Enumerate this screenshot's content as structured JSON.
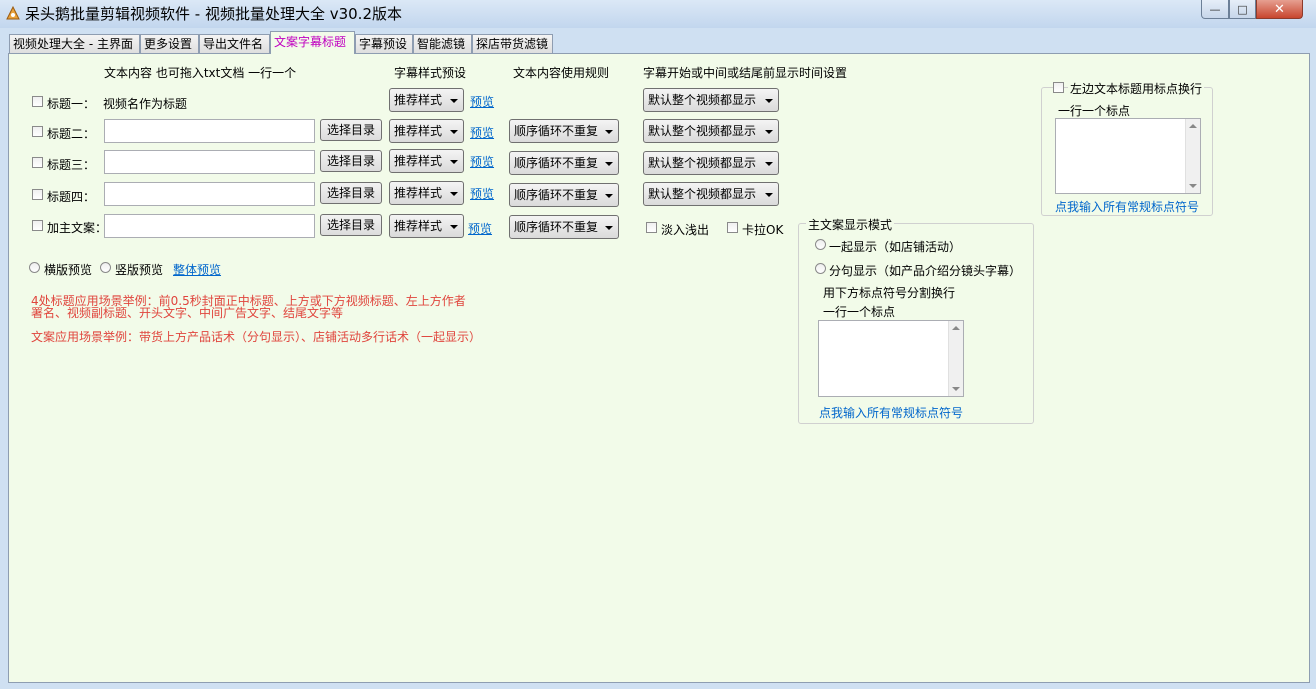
{
  "window": {
    "title": "呆头鹅批量剪辑视频软件 -  视频批量处理大全  v30.2版本",
    "min_glyph": "—",
    "max_glyph": "□",
    "close_glyph": "✕"
  },
  "tabs": [
    "视频处理大全 - 主界面",
    "更多设置",
    "导出文件名",
    "文案字幕标题",
    "字幕预设",
    "智能滤镜",
    "探店带货滤镜"
  ],
  "active_tab_index": 3,
  "headers": {
    "text_content": "文本内容 也可拖入txt文档 一行一个",
    "style_preset": "字幕样式预设",
    "usage_rule": "文本内容使用规则",
    "display_time": "字幕开始或中间或结尾前显示时间设置"
  },
  "rows": {
    "title1": {
      "label": "标题一：",
      "text": "视频名作为标题",
      "style": "推荐样式",
      "preview": "预览",
      "time": "默认整个视频都显示"
    },
    "title2": {
      "label": "标题二：",
      "value": "",
      "choose": "选择目录",
      "style": "推荐样式",
      "preview": "预览",
      "rule": "顺序循环不重复",
      "time": "默认整个视频都显示"
    },
    "title3": {
      "label": "标题三：",
      "value": "",
      "choose": "选择目录",
      "style": "推荐样式",
      "preview": "预览",
      "rule": "顺序循环不重复",
      "time": "默认整个视频都显示"
    },
    "title4": {
      "label": "标题四：",
      "value": "",
      "choose": "选择目录",
      "style": "推荐样式",
      "preview": "预览",
      "rule": "顺序循环不重复",
      "time": "默认整个视频都显示"
    },
    "main": {
      "label": "加主文案：",
      "value": "",
      "choose": "选择目录",
      "style": "推荐样式",
      "preview": "预览",
      "rule": "顺序循环不重复"
    }
  },
  "effects": {
    "fade": "淡入浅出",
    "karaoke": "卡拉OK"
  },
  "preview_options": {
    "landscape": "横版预览",
    "portrait": "竖版预览",
    "overall": "整体预览"
  },
  "notes": {
    "line1": "4处标题应用场景举例：前0.5秒封面正中标题、上方或下方视频标题、左上方作者",
    "line2": "署名、视频副标题、开头文字、中间广告文字、结尾文字等",
    "line3": "文案应用场景举例：带货上方产品话术（分句显示）、店铺活动多行话术（一起显示）"
  },
  "main_mode": {
    "title": "主文案显示模式",
    "option1": "一起显示（如店铺活动）",
    "option2": "分句显示（如产品介绍分镜头字幕）",
    "split_hint": "用下方标点符号分割换行",
    "per_line": "一行一个标点",
    "link": "点我输入所有常规标点符号"
  },
  "left_punct": {
    "label": "左边文本标题用标点换行",
    "per_line": "一行一个标点",
    "link": "点我输入所有常规标点符号"
  }
}
